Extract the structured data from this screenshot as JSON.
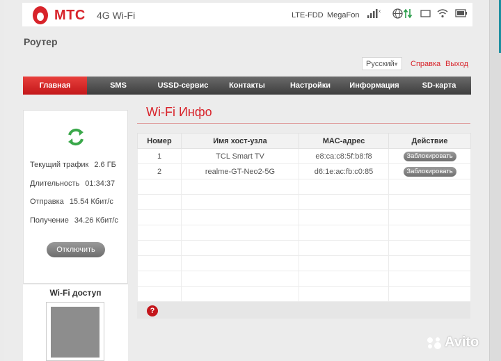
{
  "header": {
    "brand": "МТС",
    "product": "4G Wi-Fi",
    "network_type": "LTE-FDD",
    "operator": "MegaFon",
    "icons": [
      "signal-icon",
      "globe-icon",
      "updown-arrows-icon",
      "sim-icon",
      "wifi-icon",
      "battery-icon"
    ]
  },
  "page": {
    "section_title": "Роутер",
    "language": "Русский",
    "help_link": "Справка",
    "logout_link": "Выход"
  },
  "nav": [
    "Главная",
    "SMS",
    "USSD-сервис",
    "Контакты",
    "Настройки",
    "Информация",
    "SD-карта"
  ],
  "stats": {
    "traffic_label": "Текущий трафик",
    "traffic_value": "2.6 ГБ",
    "duration_label": "Длительность",
    "duration_value": "01:34:37",
    "upload_label": "Отправка",
    "upload_value": "15.54 Кбит/с",
    "download_label": "Получение",
    "download_value": "34.26 Кбит/с",
    "disconnect_label": "Отключить"
  },
  "wifi_access": {
    "title": "Wi-Fi доступ"
  },
  "wifi_info": {
    "title": "Wi-Fi Инфо",
    "columns": [
      "Номер",
      "Имя хост-узла",
      "MAC-адрес",
      "Действие"
    ],
    "rows": [
      {
        "num": "1",
        "host": "TCL Smart TV",
        "mac": "e8:ca:c8:5f:b8:f8",
        "action": "Заблокировать"
      },
      {
        "num": "2",
        "host": "realme-GT-Neo2-5G",
        "mac": "d6:1e:ac:fb:c0:85",
        "action": "Заблокировать"
      }
    ]
  },
  "watermark": "Avito",
  "colors": {
    "accent": "#d8232a",
    "nav_dark": "#4a4a4a",
    "active_red": "#d0201f"
  }
}
